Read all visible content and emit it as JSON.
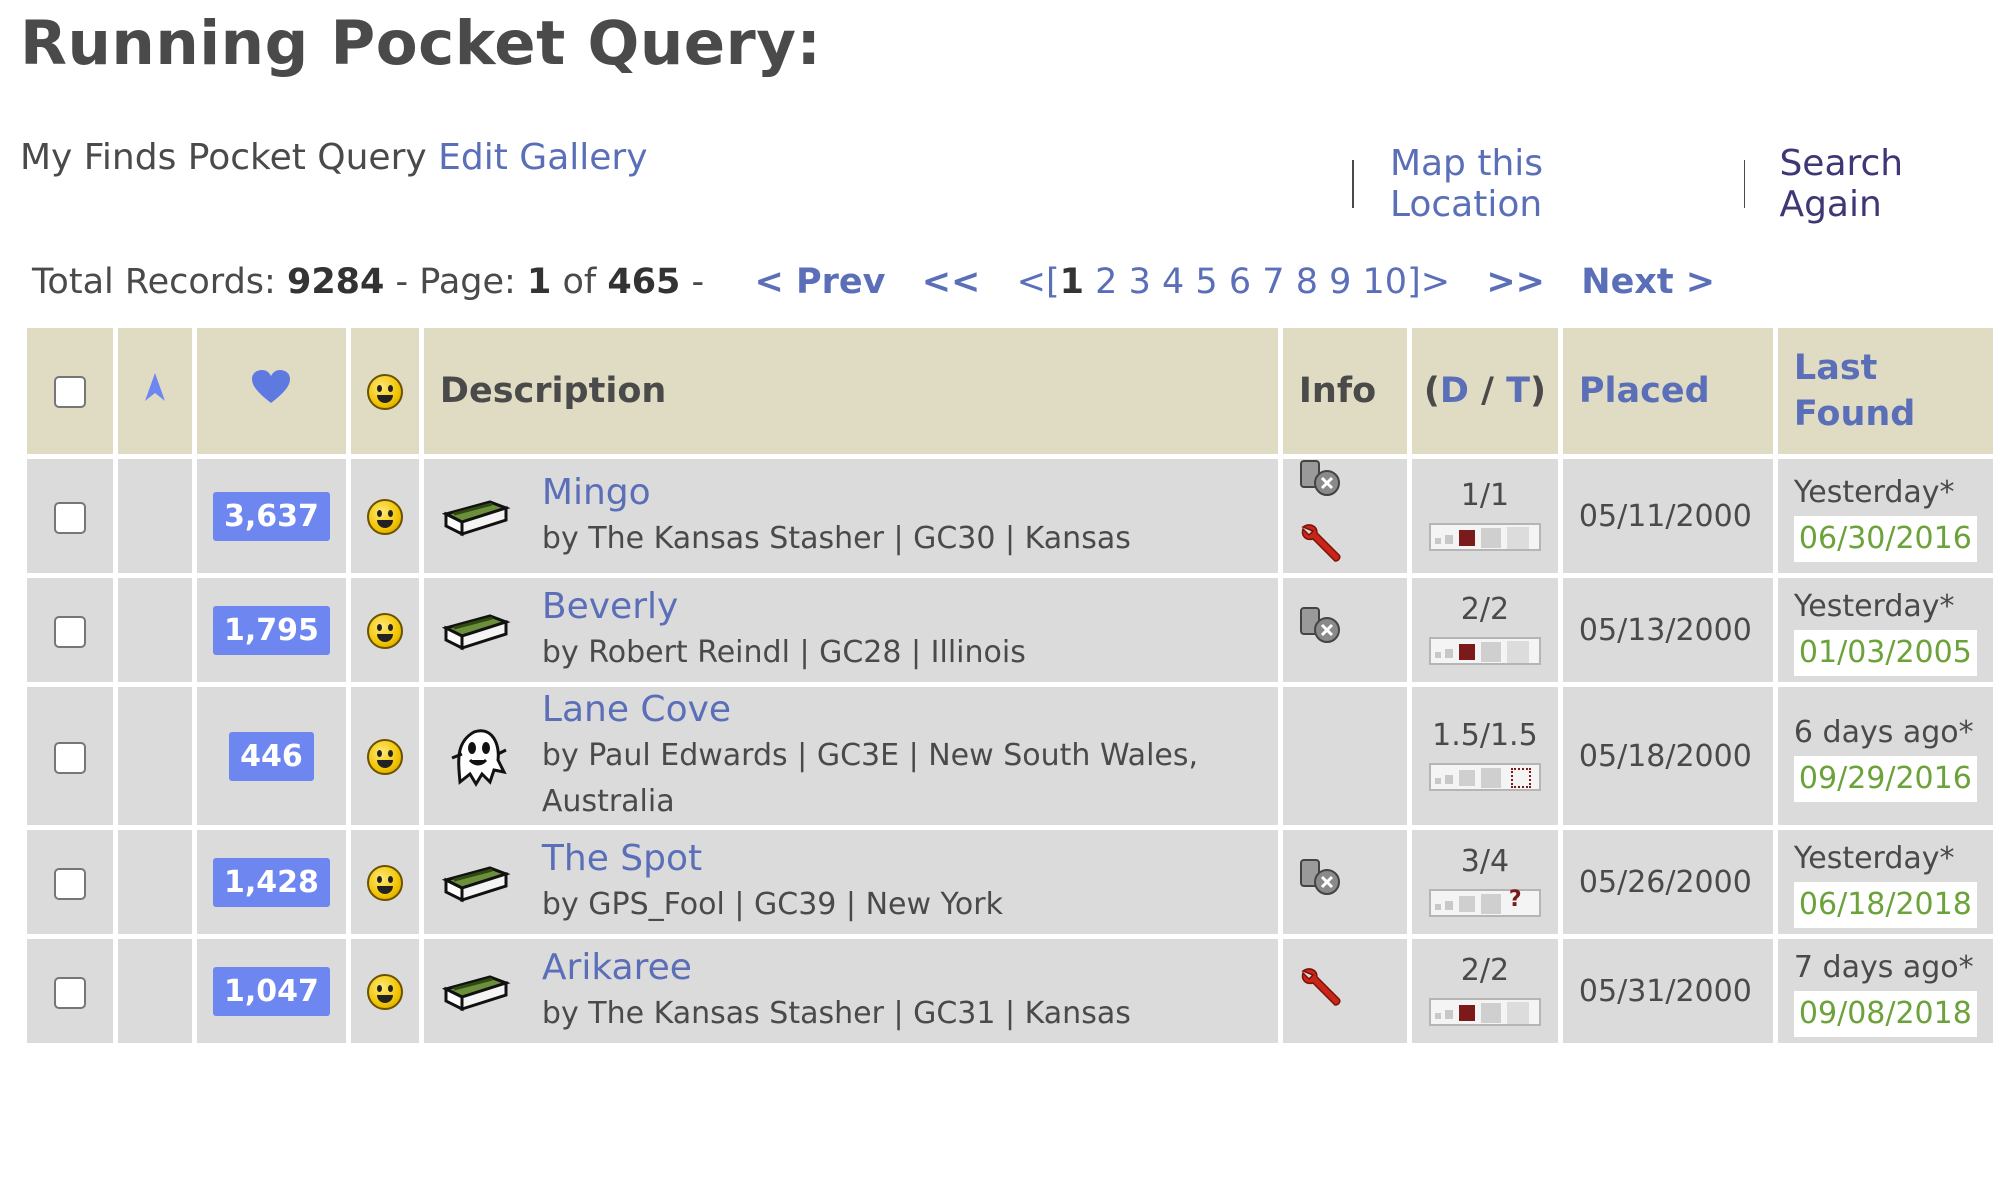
{
  "page": {
    "title": "Running Pocket Query:",
    "query_name": "My Finds Pocket Query",
    "edit_gallery": "Edit Gallery",
    "map_location": "Map this Location",
    "search_again": "Search Again"
  },
  "pager": {
    "total_label": "Total Records:",
    "total": "9284",
    "page_label": "- Page:",
    "page": "1",
    "of_label": "of",
    "pages": "465",
    "dash": "-",
    "prev": "< Prev",
    "first": "<<",
    "open_bracket": "<[",
    "current": "1",
    "page_numbers": [
      "2",
      "3",
      "4",
      "5",
      "6",
      "7",
      "8",
      "9",
      "10"
    ],
    "close_bracket": "]>",
    "last": ">>",
    "next": "Next >"
  },
  "table": {
    "headers": {
      "description": "Description",
      "info": "Info",
      "dt_open": "(",
      "d": "D",
      "slash": "/",
      "t": "T",
      "dt_close": ")",
      "placed": "Placed",
      "last_found_1": "Last",
      "last_found_2": "Found"
    },
    "rows": [
      {
        "favorites": "3,637",
        "name": "Mingo",
        "owner_line": "by The Kansas Stasher | GC30 | Kansas",
        "type_icon": "traditional-cache-icon",
        "info_icons": [
          "trackable-icon",
          "needs-maintenance-icon"
        ],
        "dt": "1/1",
        "size": "micro",
        "placed": "05/11/2000",
        "last_found": "Yesterday*",
        "found_date": "06/30/2016"
      },
      {
        "favorites": "1,795",
        "name": "Beverly",
        "owner_line": "by Robert Reindl | GC28 | Illinois",
        "type_icon": "traditional-cache-icon",
        "info_icons": [
          "trackable-icon"
        ],
        "dt": "2/2",
        "size": "micro",
        "placed": "05/13/2000",
        "last_found": "Yesterday*",
        "found_date": "01/03/2005"
      },
      {
        "favorites": "446",
        "name": "Lane Cove",
        "owner_line": "by Paul Edwards | GC3E | New South Wales, Australia",
        "type_icon": "virtual-cache-icon",
        "info_icons": [],
        "dt": "1.5/1.5",
        "size": "virtual",
        "placed": "05/18/2000",
        "last_found": "6 days ago*",
        "found_date": "09/29/2016"
      },
      {
        "favorites": "1,428",
        "name": "The Spot",
        "owner_line": "by GPS_Fool | GC39 | New York",
        "type_icon": "traditional-cache-icon",
        "info_icons": [
          "trackable-icon"
        ],
        "dt": "3/4",
        "size": "unknown",
        "placed": "05/26/2000",
        "last_found": "Yesterday*",
        "found_date": "06/18/2018"
      },
      {
        "favorites": "1,047",
        "name": "Arikaree",
        "owner_line": "by The Kansas Stasher | GC31 | Kansas",
        "type_icon": "traditional-cache-icon",
        "info_icons": [
          "needs-maintenance-icon"
        ],
        "dt": "2/2",
        "size": "micro",
        "placed": "05/31/2000",
        "last_found": "7 days ago*",
        "found_date": "09/08/2018"
      }
    ]
  },
  "colors": {
    "link": "#5a6fb8",
    "header_bg": "#e0dcc4",
    "row_bg": "#dbdbdb",
    "favorite_badge": "#6e86f0",
    "found_date": "#6ca23a"
  }
}
